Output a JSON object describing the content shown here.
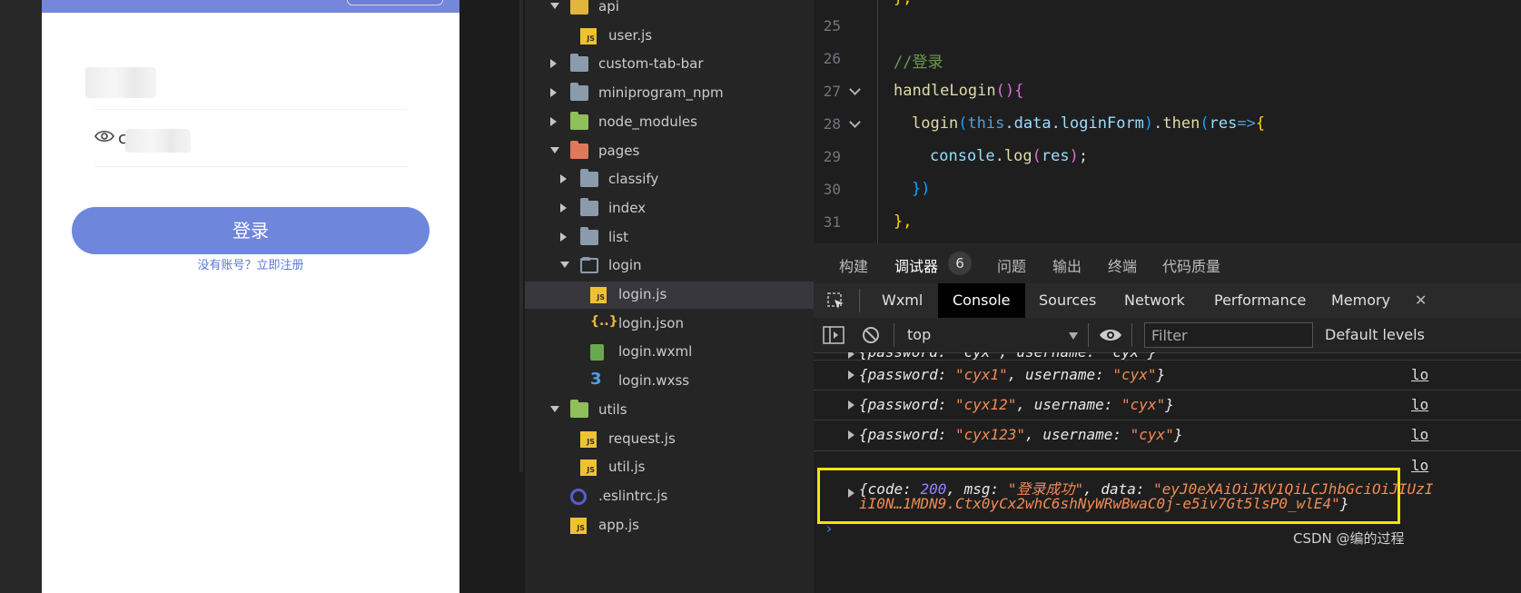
{
  "simulator": {
    "password_prefix": "c",
    "login_button": "登录",
    "register_link": "没有账号？立即注册"
  },
  "explorer": {
    "items": [
      {
        "label": "api",
        "type": "folder-api",
        "expanded": true,
        "depth": 0
      },
      {
        "label": "user.js",
        "type": "js",
        "depth": 1
      },
      {
        "label": "custom-tab-bar",
        "type": "folder",
        "expanded": false,
        "depth": 0
      },
      {
        "label": "miniprogram_npm",
        "type": "folder",
        "expanded": false,
        "depth": 0
      },
      {
        "label": "node_modules",
        "type": "folder-node",
        "expanded": false,
        "depth": 0
      },
      {
        "label": "pages",
        "type": "folder-pages",
        "expanded": true,
        "depth": 0
      },
      {
        "label": "classify",
        "type": "folder",
        "expanded": false,
        "depth": 1
      },
      {
        "label": "index",
        "type": "folder",
        "expanded": false,
        "depth": 1
      },
      {
        "label": "list",
        "type": "folder",
        "expanded": false,
        "depth": 1
      },
      {
        "label": "login",
        "type": "folder-open",
        "expanded": true,
        "depth": 1
      },
      {
        "label": "login.js",
        "type": "js",
        "depth": 2,
        "selected": true
      },
      {
        "label": "login.json",
        "type": "json",
        "depth": 2
      },
      {
        "label": "login.wxml",
        "type": "wxml",
        "depth": 2
      },
      {
        "label": "login.wxss",
        "type": "wxss",
        "depth": 2
      },
      {
        "label": "utils",
        "type": "folder-utils",
        "expanded": true,
        "depth": 0
      },
      {
        "label": "request.js",
        "type": "js",
        "depth": 1
      },
      {
        "label": "util.js",
        "type": "js",
        "depth": 1
      },
      {
        "label": ".eslintrc.js",
        "type": "eslint",
        "depth": 0
      },
      {
        "label": "app.js",
        "type": "js",
        "depth": 0
      }
    ]
  },
  "editor": {
    "lines": [
      {
        "num": "25"
      },
      {
        "num": "26",
        "comment": "//登录"
      },
      {
        "num": "27",
        "fn": "handleLogin",
        "rest": "(){"
      },
      {
        "num": "28",
        "fn": "login",
        "this": "this",
        "prop": ".data.loginForm",
        "then": "then",
        "param": "res",
        "arrow": "=>"
      },
      {
        "num": "29",
        "obj": "console",
        "method": "log",
        "arg": "res"
      },
      {
        "num": "30",
        "close": "})"
      },
      {
        "num": "31",
        "close": "},"
      }
    ]
  },
  "panel": {
    "tabs": [
      "构建",
      "调试器",
      "问题",
      "输出",
      "终端",
      "代码质量"
    ],
    "badge": "6",
    "devtools_tabs": [
      "Wxml",
      "Console",
      "Sources",
      "Network",
      "Performance",
      "Memory"
    ],
    "context": "top",
    "filter_placeholder": "Filter",
    "levels": "Default levels",
    "logs": [
      {
        "pw": "cyx1",
        "user": "cyx",
        "src": "lo"
      },
      {
        "pw": "cyx12",
        "user": "cyx",
        "src": "lo"
      },
      {
        "pw": "cyx123",
        "user": "cyx",
        "src": "lo"
      }
    ],
    "partial_log": "{password: \"cyx\", username: \"cyx\"}",
    "result": {
      "code": "200",
      "msg": "登录成功",
      "data_line1": "eyJ0eXAiOiJKV1QiLCJhbGciOiJIUzI",
      "data_line2": "iI0N…1MDN9.Ctx0yCx2whC6shNyWRwBwaC0j-e5iv7Gt5lsP0_wlE4",
      "src": "lo"
    },
    "watermark": "CSDN @编的过程"
  }
}
